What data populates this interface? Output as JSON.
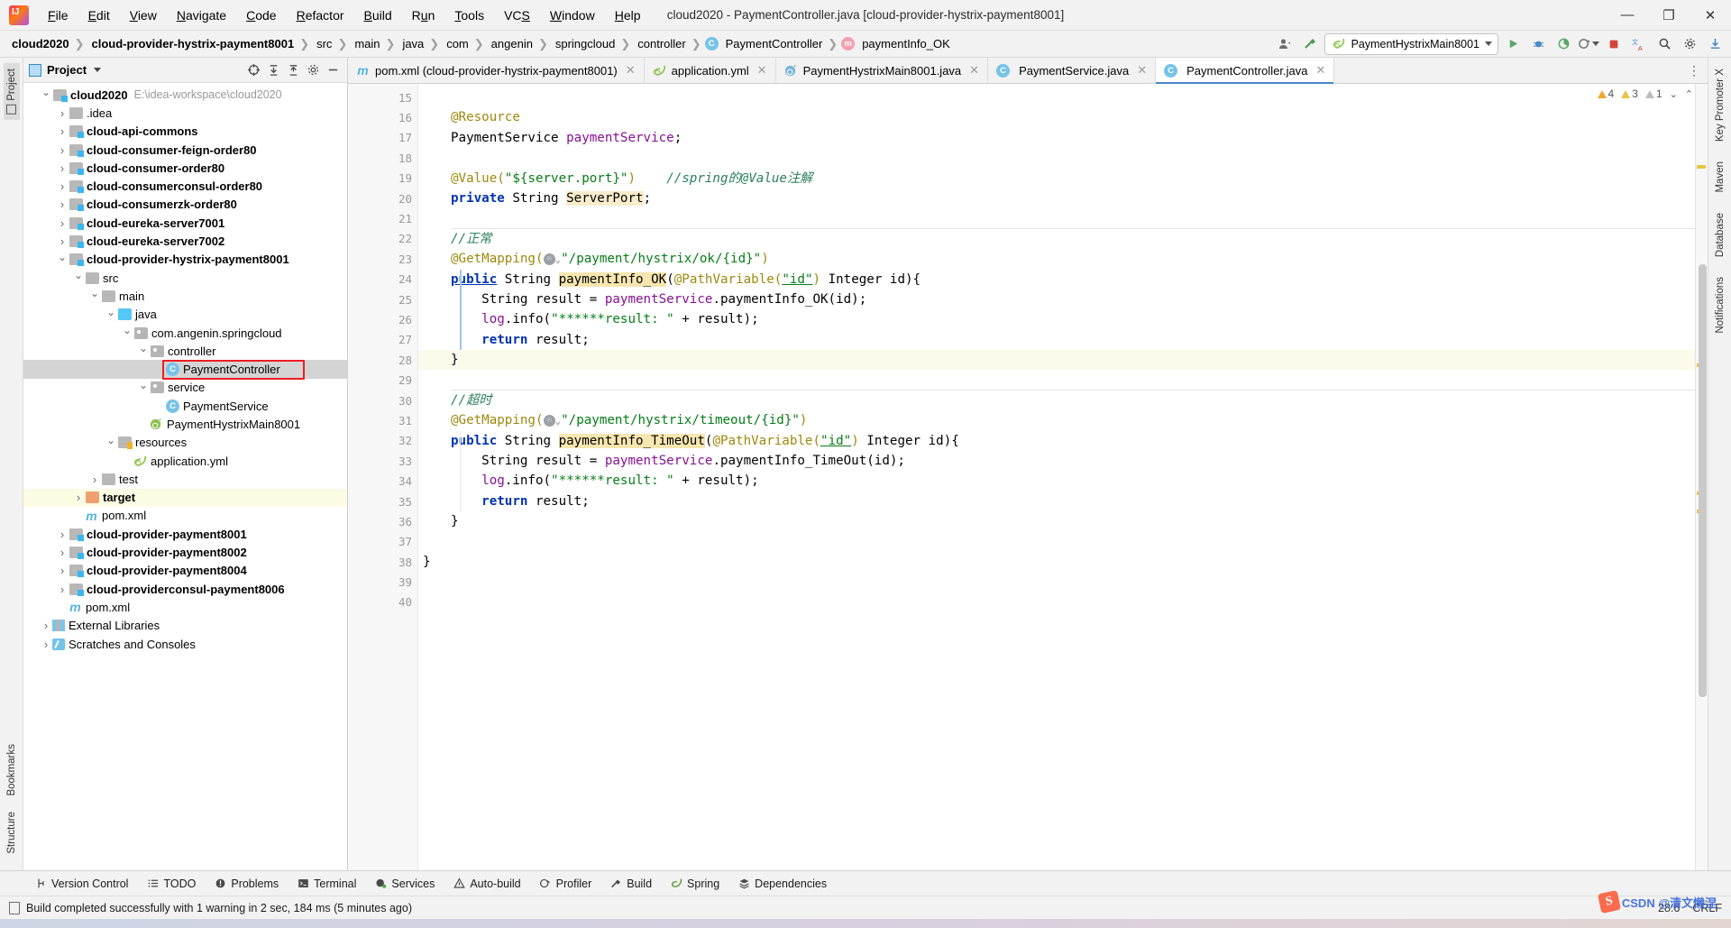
{
  "window": {
    "title": "cloud2020 - PaymentController.java [cloud-provider-hystrix-payment8001]",
    "minimize": "—",
    "maximize": "❐",
    "close": "✕"
  },
  "menubar": [
    {
      "label": "File",
      "mnemonic": "F"
    },
    {
      "label": "Edit",
      "mnemonic": "E"
    },
    {
      "label": "View",
      "mnemonic": "V"
    },
    {
      "label": "Navigate",
      "mnemonic": "N"
    },
    {
      "label": "Code",
      "mnemonic": "C"
    },
    {
      "label": "Refactor",
      "mnemonic": "R"
    },
    {
      "label": "Build",
      "mnemonic": "B"
    },
    {
      "label": "Run",
      "mnemonic": "R"
    },
    {
      "label": "Tools",
      "mnemonic": "T"
    },
    {
      "label": "VCS",
      "mnemonic": "S"
    },
    {
      "label": "Window",
      "mnemonic": "W"
    },
    {
      "label": "Help",
      "mnemonic": "H"
    }
  ],
  "breadcrumb": [
    {
      "label": "cloud2020",
      "bold": true,
      "icon": null
    },
    {
      "label": "cloud-provider-hystrix-payment8001",
      "bold": true,
      "icon": null
    },
    {
      "label": "src",
      "bold": false,
      "icon": null
    },
    {
      "label": "main",
      "bold": false,
      "icon": null
    },
    {
      "label": "java",
      "bold": false,
      "icon": null
    },
    {
      "label": "com",
      "bold": false,
      "icon": null
    },
    {
      "label": "angenin",
      "bold": false,
      "icon": null
    },
    {
      "label": "springcloud",
      "bold": false,
      "icon": null
    },
    {
      "label": "controller",
      "bold": false,
      "icon": null
    },
    {
      "label": "PaymentController",
      "bold": false,
      "icon": "class"
    },
    {
      "label": "paymentInfo_OK",
      "bold": false,
      "icon": "method"
    }
  ],
  "run_config": {
    "name": "PaymentHystrixMain8001",
    "icon": "spring-boot-icon"
  },
  "project_panel": {
    "title": "Project",
    "tree": [
      {
        "depth": 0,
        "arrow": "open",
        "icon": "module",
        "label": "cloud2020",
        "bold": true,
        "path": "E:\\idea-workspace\\cloud2020"
      },
      {
        "depth": 1,
        "arrow": "closed",
        "icon": "folder",
        "label": ".idea",
        "bold": false
      },
      {
        "depth": 1,
        "arrow": "closed",
        "icon": "module",
        "label": "cloud-api-commons",
        "bold": true
      },
      {
        "depth": 1,
        "arrow": "closed",
        "icon": "module",
        "label": "cloud-consumer-feign-order80",
        "bold": true
      },
      {
        "depth": 1,
        "arrow": "closed",
        "icon": "module",
        "label": "cloud-consumer-order80",
        "bold": true
      },
      {
        "depth": 1,
        "arrow": "closed",
        "icon": "module",
        "label": "cloud-consumerconsul-order80",
        "bold": true
      },
      {
        "depth": 1,
        "arrow": "closed",
        "icon": "module",
        "label": "cloud-consumerzk-order80",
        "bold": true
      },
      {
        "depth": 1,
        "arrow": "closed",
        "icon": "module",
        "label": "cloud-eureka-server7001",
        "bold": true
      },
      {
        "depth": 1,
        "arrow": "closed",
        "icon": "module",
        "label": "cloud-eureka-server7002",
        "bold": true
      },
      {
        "depth": 1,
        "arrow": "open",
        "icon": "module",
        "label": "cloud-provider-hystrix-payment8001",
        "bold": true
      },
      {
        "depth": 2,
        "arrow": "open",
        "icon": "folder",
        "label": "src",
        "bold": false
      },
      {
        "depth": 3,
        "arrow": "open",
        "icon": "folder",
        "label": "main",
        "bold": false
      },
      {
        "depth": 4,
        "arrow": "open",
        "icon": "source",
        "label": "java",
        "bold": false
      },
      {
        "depth": 5,
        "arrow": "open",
        "icon": "package",
        "label": "com.angenin.springcloud",
        "bold": false
      },
      {
        "depth": 6,
        "arrow": "open",
        "icon": "package",
        "label": "controller",
        "bold": false
      },
      {
        "depth": 7,
        "arrow": "none",
        "icon": "class",
        "label": "PaymentController",
        "bold": false,
        "selected": true,
        "highlighted": true
      },
      {
        "depth": 6,
        "arrow": "open",
        "icon": "package",
        "label": "service",
        "bold": false
      },
      {
        "depth": 7,
        "arrow": "none",
        "icon": "class",
        "label": "PaymentService",
        "bold": false
      },
      {
        "depth": 6,
        "arrow": "none",
        "icon": "spring",
        "label": "PaymentHystrixMain8001",
        "bold": false
      },
      {
        "depth": 4,
        "arrow": "open",
        "icon": "resources",
        "label": "resources",
        "bold": false
      },
      {
        "depth": 5,
        "arrow": "none",
        "icon": "yml",
        "label": "application.yml",
        "bold": false
      },
      {
        "depth": 3,
        "arrow": "closed",
        "icon": "folder",
        "label": "test",
        "bold": false
      },
      {
        "depth": 2,
        "arrow": "closed",
        "icon": "target",
        "label": "target",
        "bold": true,
        "target": true
      },
      {
        "depth": 2,
        "arrow": "none",
        "icon": "maven",
        "label": "pom.xml",
        "bold": false
      },
      {
        "depth": 1,
        "arrow": "closed",
        "icon": "module",
        "label": "cloud-provider-payment8001",
        "bold": true
      },
      {
        "depth": 1,
        "arrow": "closed",
        "icon": "module",
        "label": "cloud-provider-payment8002",
        "bold": true
      },
      {
        "depth": 1,
        "arrow": "closed",
        "icon": "module",
        "label": "cloud-provider-payment8004",
        "bold": true
      },
      {
        "depth": 1,
        "arrow": "closed",
        "icon": "module",
        "label": "cloud-providerconsul-payment8006",
        "bold": true
      },
      {
        "depth": 1,
        "arrow": "none",
        "icon": "maven",
        "label": "pom.xml",
        "bold": false
      },
      {
        "depth": 0,
        "arrow": "closed",
        "icon": "library",
        "label": "External Libraries",
        "bold": false
      },
      {
        "depth": 0,
        "arrow": "closed",
        "icon": "scratch",
        "label": "Scratches and Consoles",
        "bold": false
      }
    ]
  },
  "left_strip": [
    {
      "label": "Project",
      "active": true
    },
    {
      "label": "Bookmarks",
      "active": false
    },
    {
      "label": "Structure",
      "active": false
    }
  ],
  "right_strip": [
    {
      "label": "Key Promoter X"
    },
    {
      "label": "Maven"
    },
    {
      "label": "Database"
    },
    {
      "label": "Notifications"
    }
  ],
  "tabs": [
    {
      "label": "pom.xml (cloud-provider-hystrix-payment8001)",
      "icon": "maven-icon",
      "active": false
    },
    {
      "label": "application.yml",
      "icon": "spring-icon",
      "active": false
    },
    {
      "label": "PaymentHystrixMain8001.java",
      "icon": "spring-boot-icon",
      "active": false
    },
    {
      "label": "PaymentService.java",
      "icon": "class-icon",
      "active": false
    },
    {
      "label": "PaymentController.java",
      "icon": "class-icon",
      "active": true
    }
  ],
  "inspections": {
    "errors": "4",
    "warnings": "3",
    "weak": "1"
  },
  "editor": {
    "first_line": 15,
    "lines": [
      {
        "n": 15,
        "text": ""
      },
      {
        "n": 16,
        "text": "    @Resource",
        "gutter_icon": null
      },
      {
        "n": 17,
        "text": "    PaymentService paymentService;",
        "gutter_icon": "bean-icon"
      },
      {
        "n": 18,
        "text": ""
      },
      {
        "n": 19,
        "text": "    @Value(\"${server.port}\")    //spring的@Value注解"
      },
      {
        "n": 20,
        "text": "    private String ServerPort;"
      },
      {
        "n": 21,
        "text": ""
      },
      {
        "n": 22,
        "text": "    //正常"
      },
      {
        "n": 23,
        "text": "    @GetMapping(\"/payment/hystrix/ok/{id}\")"
      },
      {
        "n": 24,
        "text": "    public String paymentInfo_OK(@PathVariable(\"id\") Integer id){",
        "gutter_icon": "mapping-icon"
      },
      {
        "n": 25,
        "text": "        String result = paymentService.paymentInfo_OK(id);"
      },
      {
        "n": 26,
        "text": "        log.info(\"******result: \" + result);"
      },
      {
        "n": 27,
        "text": "        return result;"
      },
      {
        "n": 28,
        "text": "    }",
        "highlight": true
      },
      {
        "n": 29,
        "text": ""
      },
      {
        "n": 30,
        "text": "    //超时"
      },
      {
        "n": 31,
        "text": "    @GetMapping(\"/payment/hystrix/timeout/{id}\")"
      },
      {
        "n": 32,
        "text": "    public String paymentInfo_TimeOut(@PathVariable(\"id\") Integer id){",
        "gutter_icon": "mapping-icon"
      },
      {
        "n": 33,
        "text": "        String result = paymentService.paymentInfo_TimeOut(id);"
      },
      {
        "n": 34,
        "text": "        log.info(\"******result: \" + result);"
      },
      {
        "n": 35,
        "text": "        return result;"
      },
      {
        "n": 36,
        "text": "    }"
      },
      {
        "n": 37,
        "text": ""
      },
      {
        "n": 38,
        "text": "}"
      },
      {
        "n": 39,
        "text": ""
      },
      {
        "n": 40,
        "text": ""
      }
    ]
  },
  "tool_windows": [
    {
      "label": "Version Control",
      "icon": "branch-icon"
    },
    {
      "label": "TODO",
      "icon": "list-icon"
    },
    {
      "label": "Problems",
      "icon": "error-icon"
    },
    {
      "label": "Terminal",
      "icon": "terminal-icon"
    },
    {
      "label": "Services",
      "icon": "services-icon"
    },
    {
      "label": "Auto-build",
      "icon": "warning-icon"
    },
    {
      "label": "Profiler",
      "icon": "profiler-icon"
    },
    {
      "label": "Build",
      "icon": "hammer-icon"
    },
    {
      "label": "Spring",
      "icon": "spring-icon"
    },
    {
      "label": "Dependencies",
      "icon": "layers-icon"
    }
  ],
  "status_bar": {
    "message": "Build completed successfully with 1 warning in 2 sec, 184 ms (5 minutes ago)",
    "caret_position": "28:6",
    "line_separator": "CRLF"
  },
  "watermark": {
    "logo": "S",
    "text": "CSDN @清文懒涅"
  },
  "colors": {
    "accent": "#4a86c8",
    "keyword": "#0033b3",
    "string": "#067d17",
    "annotation": "#9e880d",
    "field": "#871094",
    "comment_doc": "#2b7f5f",
    "highlight_box": "#ed1c24",
    "selection": "#d4d4d4",
    "target_folder": "#fcfbe3"
  }
}
